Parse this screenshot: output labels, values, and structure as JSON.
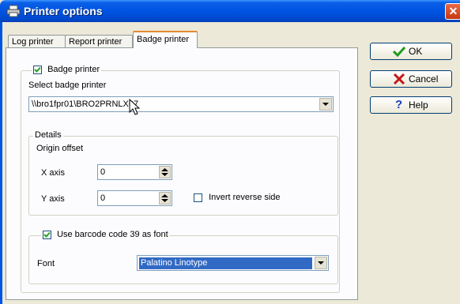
{
  "window": {
    "title": "Printer options",
    "title_icon": "printer-icon",
    "close_icon": "close-icon"
  },
  "tabs": [
    {
      "label": "Log printer"
    },
    {
      "label": "Report printer"
    },
    {
      "label": "Badge printer",
      "active": true
    }
  ],
  "badge": {
    "enable_label": "Badge printer",
    "enable_checked": true,
    "select_label": "Select badge printer",
    "printer_value": "\\\\bro1fpr01\\BRO2PRNLX07"
  },
  "details": {
    "legend": "Details",
    "origin_label": "Origin offset",
    "x_label": "X axis",
    "x_value": "0",
    "y_label": "Y axis",
    "y_value": "0",
    "invert_label": "Invert reverse side",
    "invert_checked": false
  },
  "barcode": {
    "label": "Use barcode code 39 as font",
    "checked": true,
    "font_label": "Font",
    "font_value": "Palatino Linotype"
  },
  "buttons": {
    "ok": "OK",
    "cancel": "Cancel",
    "help": "Help"
  },
  "colors": {
    "titlebar": "#0054e3",
    "selection": "#316ac5",
    "tab_highlight": "#e68b2c"
  }
}
